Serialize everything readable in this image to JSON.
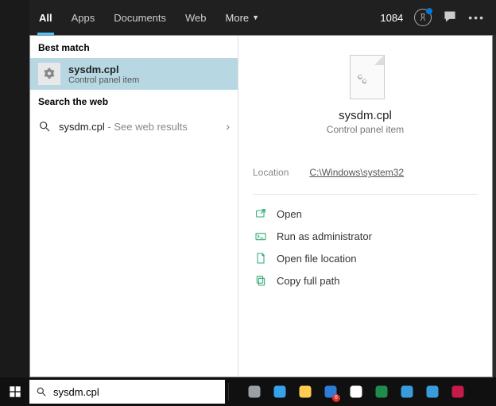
{
  "filterbar": {
    "tabs": [
      "All",
      "Apps",
      "Documents",
      "Web"
    ],
    "more_label": "More",
    "count": "1084"
  },
  "left": {
    "best_label": "Best match",
    "best_match": {
      "title": "sysdm.cpl",
      "subtitle": "Control panel item"
    },
    "web_label": "Search the web",
    "web_result": {
      "term": "sysdm.cpl",
      "hint": " - See web results"
    }
  },
  "preview": {
    "title": "sysdm.cpl",
    "subtitle": "Control panel item",
    "meta_key": "Location",
    "meta_val": "C:\\Windows\\system32",
    "actions": {
      "open": "Open",
      "admin": "Run as administrator",
      "loc": "Open file location",
      "copy": "Copy full path"
    }
  },
  "taskbar": {
    "search_value": "sysdm.cpl",
    "items": [
      {
        "name": "task-view-icon",
        "color": "#9aa0a6"
      },
      {
        "name": "edge-icon",
        "color": "#34a3eb"
      },
      {
        "name": "file-explorer-icon",
        "color": "#ffcc52"
      },
      {
        "name": "security-icon",
        "color": "#2e7cd6",
        "badge": "6"
      },
      {
        "name": "chrome-icon",
        "color": "#ffffff"
      },
      {
        "name": "excel-icon",
        "color": "#1f8b4c"
      },
      {
        "name": "app-icon-1",
        "color": "#3a9bdc"
      },
      {
        "name": "app-icon-2",
        "color": "#3a9bdc"
      },
      {
        "name": "raspberry-icon",
        "color": "#c51a4a"
      }
    ]
  }
}
